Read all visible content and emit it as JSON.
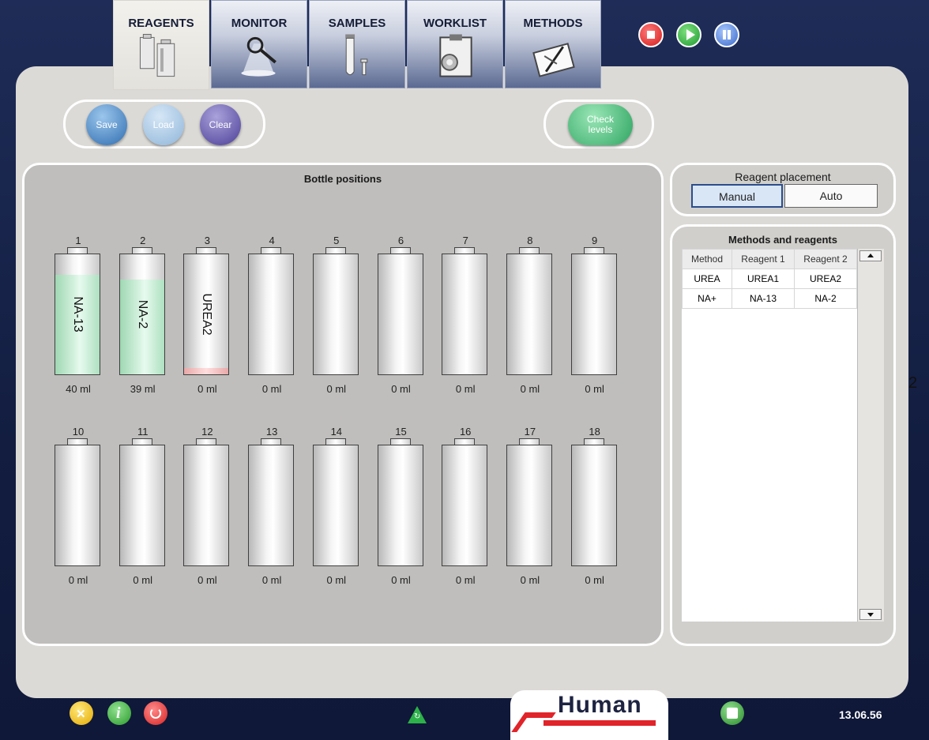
{
  "tabs": [
    {
      "label": "REAGENTS",
      "icon": "reagents-icon",
      "active": true
    },
    {
      "label": "MONITOR",
      "icon": "monitor-icon"
    },
    {
      "label": "SAMPLES",
      "icon": "samples-icon"
    },
    {
      "label": "WORKLIST",
      "icon": "worklist-icon"
    },
    {
      "label": "METHODS",
      "icon": "methods-icon"
    }
  ],
  "controls": {
    "stop": "stop-icon",
    "play": "play-icon",
    "pause": "pause-icon"
  },
  "toolbar": {
    "save": "Save",
    "load": "Load",
    "clear": "Clear",
    "check_line1": "Check",
    "check_line2": "levels"
  },
  "bottles": {
    "title": "Bottle positions",
    "items": [
      {
        "num": "1",
        "volume": "40 ml",
        "label": "NA-13",
        "fill": 0.83,
        "color": "green"
      },
      {
        "num": "2",
        "volume": "39 ml",
        "label": "NA-2",
        "fill": 0.79,
        "color": "green"
      },
      {
        "num": "3",
        "volume": "0 ml",
        "label": "UREA2",
        "fill": 0.05,
        "color": "red"
      },
      {
        "num": "4",
        "volume": "0 ml",
        "label": ""
      },
      {
        "num": "5",
        "volume": "0 ml",
        "label": ""
      },
      {
        "num": "6",
        "volume": "0 ml",
        "label": ""
      },
      {
        "num": "7",
        "volume": "0 ml",
        "label": ""
      },
      {
        "num": "8",
        "volume": "0 ml",
        "label": ""
      },
      {
        "num": "9",
        "volume": "0 ml",
        "label": ""
      },
      {
        "num": "10",
        "volume": "0 ml",
        "label": ""
      },
      {
        "num": "11",
        "volume": "0 ml",
        "label": ""
      },
      {
        "num": "12",
        "volume": "0 ml",
        "label": ""
      },
      {
        "num": "13",
        "volume": "0 ml",
        "label": ""
      },
      {
        "num": "14",
        "volume": "0 ml",
        "label": ""
      },
      {
        "num": "15",
        "volume": "0 ml",
        "label": ""
      },
      {
        "num": "16",
        "volume": "0 ml",
        "label": ""
      },
      {
        "num": "17",
        "volume": "0 ml",
        "label": ""
      },
      {
        "num": "18",
        "volume": "0 ml",
        "label": ""
      }
    ]
  },
  "placement": {
    "title": "Reagent placement",
    "manual": "Manual",
    "auto": "Auto",
    "selected": "Manual"
  },
  "methods": {
    "title": "Methods and reagents",
    "headers": [
      "Method",
      "Reagent 1",
      "Reagent 2"
    ],
    "rows": [
      [
        "UREA",
        "UREA1",
        "UREA2"
      ],
      [
        "NA+",
        "NA-13",
        "NA-2"
      ]
    ]
  },
  "edge_text": "2",
  "footer": {
    "brand": "Human",
    "time": "13.06.56"
  },
  "colors": {
    "brand_red": "#e0242a",
    "panel": "#dcdad6",
    "frame": "#16234a"
  }
}
